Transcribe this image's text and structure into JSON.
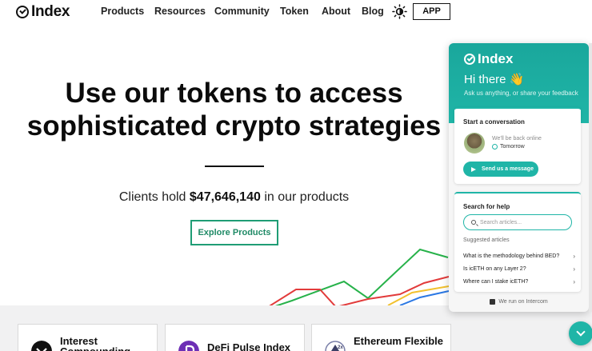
{
  "nav": {
    "logo": "Index",
    "items": [
      "Products",
      "Resources",
      "Community",
      "Token",
      "About",
      "Blog"
    ],
    "theme_icon": "sun-icon",
    "app_label": "APP"
  },
  "hero": {
    "title_line1": "Use our tokens to access",
    "title_line2": "sophisticated crypto strategies",
    "clients_prefix": "Clients hold ",
    "clients_amount": "$47,646,140",
    "clients_suffix": " in our products",
    "explore_label": "Explore Products"
  },
  "products": [
    {
      "title": "Interest Compounding",
      "icon": "interest-compounding-icon"
    },
    {
      "title": "DeFi Pulse Index",
      "icon": "defi-pulse-icon"
    },
    {
      "title": "Ethereum Flexible",
      "icon": "ethereum-flexible-icon"
    }
  ],
  "colors": {
    "accent": "#1fb5a7",
    "explore_border": "#1f9d75",
    "chart_green": "#27b24a",
    "chart_red": "#e23b3b",
    "chart_yellow": "#f2c12e",
    "chart_blue": "#2b78e4"
  },
  "widget": {
    "logo": "Index",
    "greeting": "Hi there 👋",
    "subtitle": "Ask us anything, or share your feedback",
    "convo_title": "Start a conversation",
    "back_online": "We'll be back online",
    "tomorrow": "Tomorrow",
    "send_label": "Send us a message",
    "help_title": "Search for help",
    "search_placeholder": "Search articles...",
    "suggested_label": "Suggested articles",
    "articles": [
      "What is the methodology behind BED?",
      "Is icETH on any Layer 2?",
      "Where can I stake icETH?"
    ],
    "footer": "We run on Intercom"
  }
}
